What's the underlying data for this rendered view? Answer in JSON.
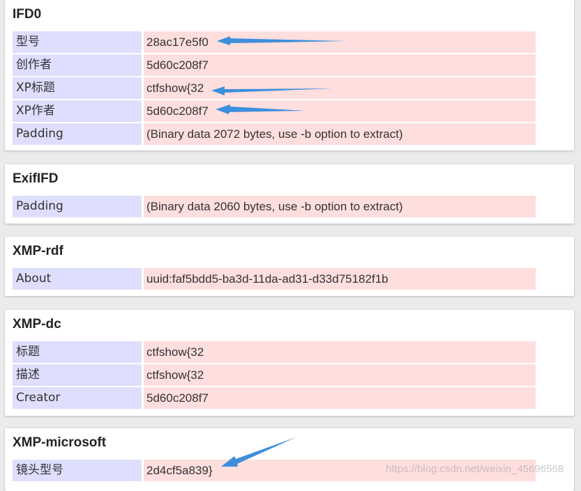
{
  "sections": [
    {
      "title": "IFD0",
      "rows": [
        {
          "key": "型号",
          "value": "28ac17e5f0"
        },
        {
          "key": "创作者",
          "value": "5d60c208f7"
        },
        {
          "key": "XP标题",
          "value": "ctfshow{32"
        },
        {
          "key": "XP作者",
          "value": "5d60c208f7"
        },
        {
          "key": "Padding",
          "value": "(Binary data 2072 bytes, use -b option to extract)"
        }
      ]
    },
    {
      "title": "ExifIFD",
      "rows": [
        {
          "key": "Padding",
          "value": "(Binary data 2060 bytes, use -b option to extract)"
        }
      ]
    },
    {
      "title": "XMP-rdf",
      "rows": [
        {
          "key": "About",
          "value": "uuid:faf5bdd5-ba3d-11da-ad31-d33d75182f1b"
        }
      ]
    },
    {
      "title": "XMP-dc",
      "rows": [
        {
          "key": "标题",
          "value": "ctfshow{32"
        },
        {
          "key": "描述",
          "value": "ctfshow{32"
        },
        {
          "key": "Creator",
          "value": "5d60c208f7"
        }
      ]
    },
    {
      "title": "XMP-microsoft",
      "rows": [
        {
          "key": "镜头型号",
          "value": "2d4cf5a839}"
        }
      ]
    }
  ],
  "annotation_color": "#3d8fdc",
  "watermark": "https://blog.csdn.net/weixin_45696568"
}
